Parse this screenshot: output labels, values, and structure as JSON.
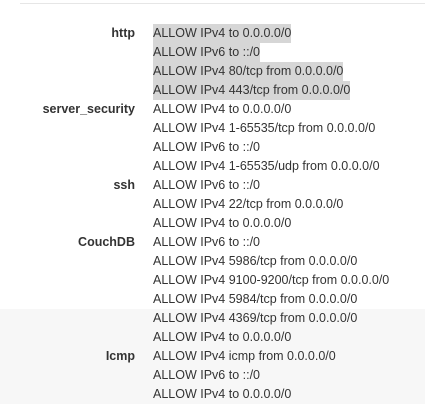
{
  "groups": [
    {
      "label": "http",
      "rules": [
        {
          "text": "ALLOW IPv4 to 0.0.0.0/0",
          "highlighted": true
        },
        {
          "text": "ALLOW IPv6 to ::/0",
          "highlighted": true
        },
        {
          "text": "ALLOW IPv4 80/tcp from 0.0.0.0/0",
          "highlighted": true
        },
        {
          "text": "ALLOW IPv4 443/tcp from 0.0.0.0/0",
          "highlighted": true
        }
      ]
    },
    {
      "label": "server_security",
      "rules": [
        {
          "text": "ALLOW IPv4 to 0.0.0.0/0"
        },
        {
          "text": "ALLOW IPv4 1-65535/tcp from 0.0.0.0/0"
        },
        {
          "text": "ALLOW IPv6 to ::/0"
        },
        {
          "text": "ALLOW IPv4 1-65535/udp from 0.0.0.0/0"
        }
      ]
    },
    {
      "label": "ssh",
      "rules": [
        {
          "text": "ALLOW IPv6 to ::/0"
        },
        {
          "text": "ALLOW IPv4 22/tcp from 0.0.0.0/0"
        },
        {
          "text": "ALLOW IPv4 to 0.0.0.0/0"
        }
      ]
    },
    {
      "label": "CouchDB",
      "rules": [
        {
          "text": "ALLOW IPv6 to ::/0"
        },
        {
          "text": "ALLOW IPv4 5986/tcp from 0.0.0.0/0"
        },
        {
          "text": "ALLOW IPv4 9100-9200/tcp from 0.0.0.0/0"
        },
        {
          "text": "ALLOW IPv4 5984/tcp from 0.0.0.0/0"
        }
      ]
    },
    {
      "label": "Icmp",
      "shaded": true,
      "rules": [
        {
          "text": "ALLOW IPv4 4369/tcp from 0.0.0.0/0"
        },
        {
          "text": "ALLOW IPv4 to 0.0.0.0/0"
        },
        {
          "text": "ALLOW IPv4 icmp from 0.0.0.0/0"
        },
        {
          "text": "ALLOW IPv6 to ::/0"
        },
        {
          "text": "ALLOW IPv4 to 0.0.0.0/0"
        }
      ]
    }
  ]
}
